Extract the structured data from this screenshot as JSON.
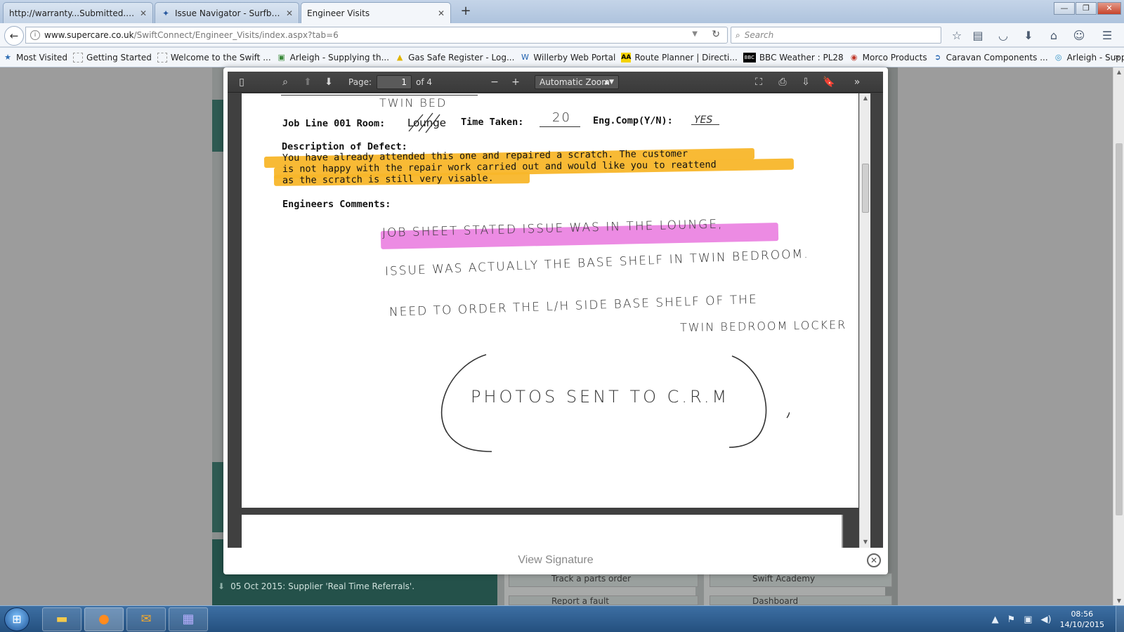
{
  "browser": {
    "tabs": [
      {
        "label": "http://warranty...Submitted.aspx",
        "active": false
      },
      {
        "label": "Issue Navigator - Surfbay C...",
        "active": false
      },
      {
        "label": "Engineer Visits",
        "active": true
      }
    ],
    "url_domain": "www.supercare.co.uk",
    "url_path": "/SwiftConnect/Engineer_Visits/index.aspx?tab=6",
    "search_placeholder": "Search",
    "bookmarks": [
      {
        "label": "Most Visited",
        "icon": "bookmark-star-icon"
      },
      {
        "label": "Getting Started",
        "icon": "page-icon"
      },
      {
        "label": "Welcome to the Swift ...",
        "icon": "page-icon"
      },
      {
        "label": "Arleigh - Supplying th...",
        "icon": "arleigh-icon"
      },
      {
        "label": "Gas Safe Register - Log...",
        "icon": "gas-safe-icon"
      },
      {
        "label": "Willerby Web Portal",
        "icon": "willerby-icon"
      },
      {
        "label": "Route Planner | Directi...",
        "icon": "aa-icon"
      },
      {
        "label": "BBC Weather : PL28",
        "icon": "bbc-icon"
      },
      {
        "label": "Morco Products",
        "icon": "morco-icon"
      },
      {
        "label": "Caravan Components ...",
        "icon": "caravan-icon"
      },
      {
        "label": "Arleigh - Supplying th...",
        "icon": "arleigh-icon"
      }
    ]
  },
  "background_page": {
    "news": "05 Oct 2015: Supplier 'Real Time Referrals'.",
    "tile_labels": [
      "Track a parts order",
      "Swift Academy",
      "Report a fault",
      "Dashboard"
    ]
  },
  "pdf_viewer": {
    "page_label": "Page:",
    "current_page": "1",
    "page_count": "of 4",
    "zoom": "Automatic Zoom"
  },
  "document": {
    "top_handwriting": "TWIN BED",
    "job_line_label": "Job Line 001 Room:",
    "room_value": "Lounge",
    "time_taken_label": "Time Taken:",
    "time_taken_value": "20",
    "eng_comp_label": "Eng.Comp(Y/N):",
    "eng_comp_value": "YES",
    "defect_heading": "Description of Defect:",
    "defect_lines": [
      "You have already attended this one and repaired a scratch. The customer",
      "is not happy with the repair work carried out and would like you to reattend",
      "as the scratch is still very visable."
    ],
    "comments_heading": "Engineers Comments:",
    "handwritten_lines": [
      "JOB SHEET STATED ISSUE WAS IN THE LOUNGE,",
      "ISSUE WAS ACTUALLY THE BASE SHELF IN TWIN BEDROOM.",
      "NEED TO ORDER THE L/H SIDE BASE SHELF OF THE",
      "TWIN BEDROOM LOCKER"
    ],
    "handwritten_note": "PHOTOS SENT TO C.R.M"
  },
  "modal": {
    "footer_label": "View Signature"
  },
  "taskbar": {
    "time": "08:56",
    "date": "14/10/2015"
  },
  "colors": {
    "highlight_yellow": "#f8b62a",
    "highlight_pink": "#ec8be3",
    "pdf_toolbar": "#3a3a3a",
    "page_accent_green": "#2e5a52"
  }
}
